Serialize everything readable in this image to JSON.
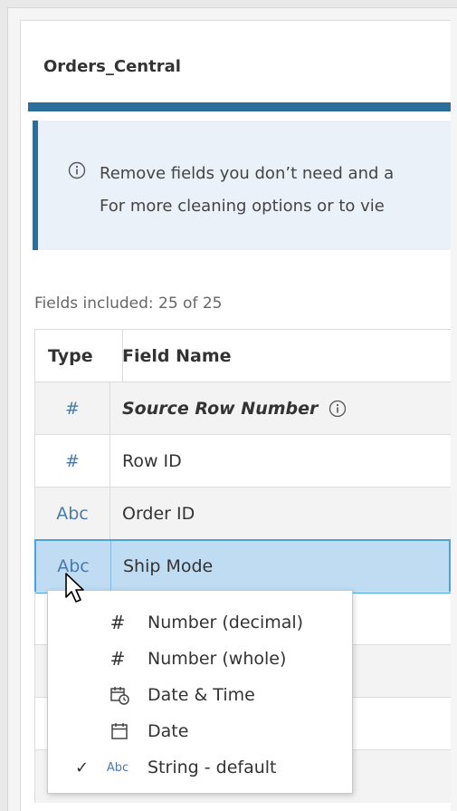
{
  "card": {
    "title": "Orders_Central",
    "info_line_1": "Remove fields you don’t need and a",
    "info_line_2": "For more cleaning options or to vie",
    "fields_included": "Fields included: 25 of 25"
  },
  "grid": {
    "headers": {
      "type": "Type",
      "name": "Field Name"
    },
    "rows": [
      {
        "type": "#",
        "name": "Source Row Number"
      },
      {
        "type": "#",
        "name": "Row ID"
      },
      {
        "type": "Abc",
        "name": "Order ID"
      },
      {
        "type": "Abc",
        "name": "Ship Mode"
      }
    ]
  },
  "type_menu": {
    "items": [
      {
        "icon": "#",
        "label": "Number (decimal)",
        "checked": ""
      },
      {
        "icon": "#",
        "label": "Number (whole)",
        "checked": ""
      },
      {
        "icon": "datetime-icon",
        "label": "Date & Time",
        "checked": ""
      },
      {
        "icon": "calendar-icon",
        "label": "Date",
        "checked": ""
      },
      {
        "icon": "Abc",
        "label": "String - default",
        "checked": "✓"
      }
    ]
  },
  "colors": {
    "accent": "#2c6e9b",
    "selected_row": "#bfdcf3",
    "info_bg": "#eaf1f8"
  }
}
